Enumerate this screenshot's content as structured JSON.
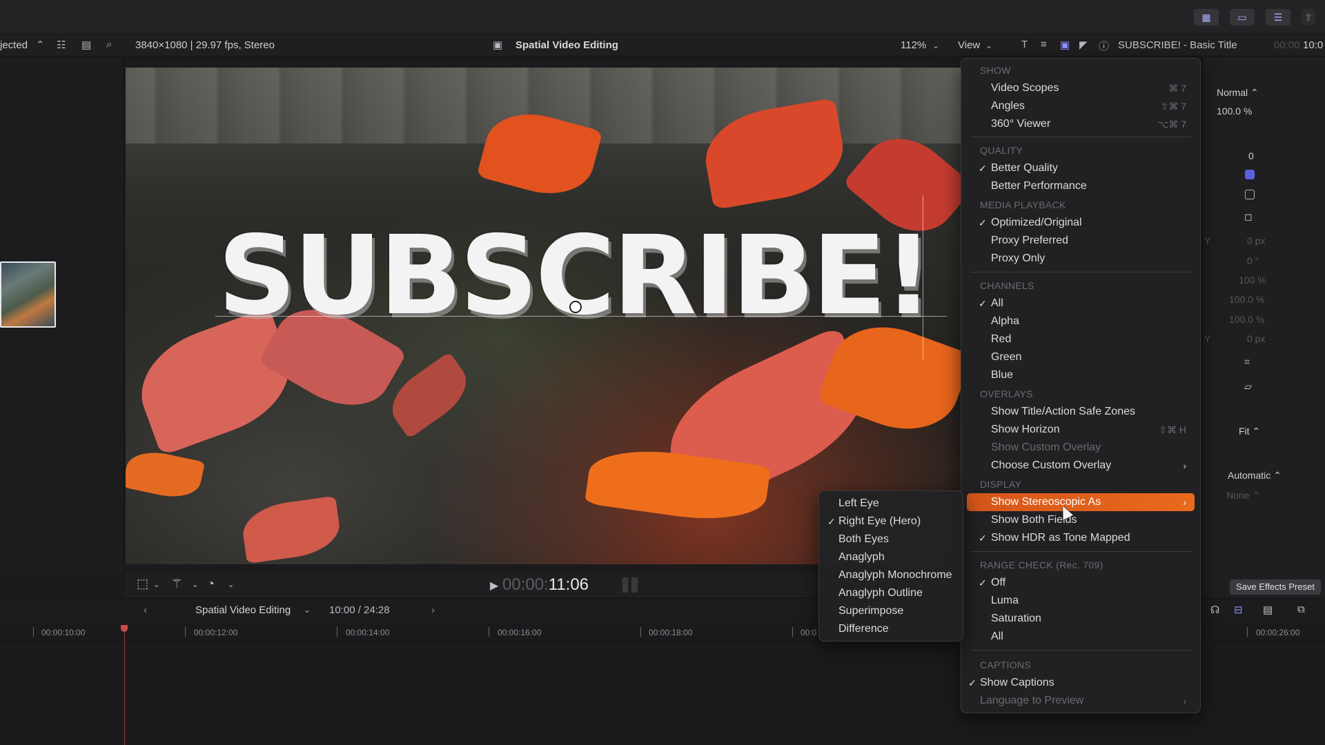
{
  "viewer_header": {
    "filter_label": "jected",
    "format_info": "3840×1080 | 29.97 fps, Stereo",
    "project_title": "Spatial Video Editing",
    "zoom": "112%",
    "view_label": "View",
    "inspector_title": "SUBSCRIBE! - Basic Title",
    "timecode_dim": "00:00",
    "timecode_right": "10:0"
  },
  "viewer": {
    "title_text": "SUBSCRIBE!"
  },
  "transport": {
    "timecode_dim": "00:00:",
    "timecode_bright": "11:06"
  },
  "timeline": {
    "project_name": "Spatial Video Editing",
    "position": "10:00 / 24:28",
    "ruler": [
      "00:00:10:00",
      "00:00:12:00",
      "00:00:14:00",
      "00:00:16:00",
      "00:00:18:00",
      "00:0",
      "00:00:26:00"
    ]
  },
  "inspector": {
    "blend_mode": "Normal ⌃",
    "opacity": "100.0 %",
    "value_zero": "0",
    "y_label_1": "Y",
    "pos_y": "0 px",
    "rotation": "0 °",
    "scale_all": "100 %",
    "scale_x": "100.0 %",
    "scale_y": "100.0 %",
    "y_label_2": "Y",
    "anchor_y": "0 px",
    "fit_label": "Fit ⌃",
    "automatic_label": "Automatic ⌃",
    "none_label": "None ⌃",
    "save_preset": "Save Effects Preset"
  },
  "view_menu": {
    "sections": {
      "show": "SHOW",
      "quality": "QUALITY",
      "media_playback": "MEDIA PLAYBACK",
      "channels": "CHANNELS",
      "overlays": "OVERLAYS",
      "display": "DISPLAY",
      "range_check": "RANGE CHECK (Rec. 709)",
      "captions": "CAPTIONS"
    },
    "items": {
      "video_scopes": "Video Scopes",
      "video_scopes_sc": "⌘ 7",
      "angles": "Angles",
      "angles_sc": "⇧⌘ 7",
      "viewer_360": "360° Viewer",
      "viewer_360_sc": "⌥⌘ 7",
      "better_quality": "Better Quality",
      "better_performance": "Better Performance",
      "optimized_original": "Optimized/Original",
      "proxy_preferred": "Proxy Preferred",
      "proxy_only": "Proxy Only",
      "ch_all": "All",
      "ch_alpha": "Alpha",
      "ch_red": "Red",
      "ch_green": "Green",
      "ch_blue": "Blue",
      "safe_zones": "Show Title/Action Safe Zones",
      "show_horizon": "Show Horizon",
      "show_horizon_sc": "⇧⌘ H",
      "show_custom_overlay": "Show Custom Overlay",
      "choose_custom_overlay": "Choose Custom Overlay",
      "show_stereoscopic": "Show Stereoscopic As",
      "show_both_fields": "Show Both Fields",
      "hdr_tone_mapped": "Show HDR as Tone Mapped",
      "rc_off": "Off",
      "rc_luma": "Luma",
      "rc_saturation": "Saturation",
      "rc_all": "All",
      "show_captions": "Show Captions",
      "language_preview": "Language to Preview"
    }
  },
  "stereo_submenu": {
    "left_eye": "Left Eye",
    "right_eye": "Right Eye (Hero)",
    "both_eyes": "Both Eyes",
    "anaglyph": "Anaglyph",
    "anaglyph_mono": "Anaglyph Monochrome",
    "anaglyph_outline": "Anaglyph Outline",
    "superimpose": "Superimpose",
    "difference": "Difference"
  },
  "colors": {
    "accent_orange": "#e2601b",
    "checkbox_blue": "#5b5fe0"
  }
}
